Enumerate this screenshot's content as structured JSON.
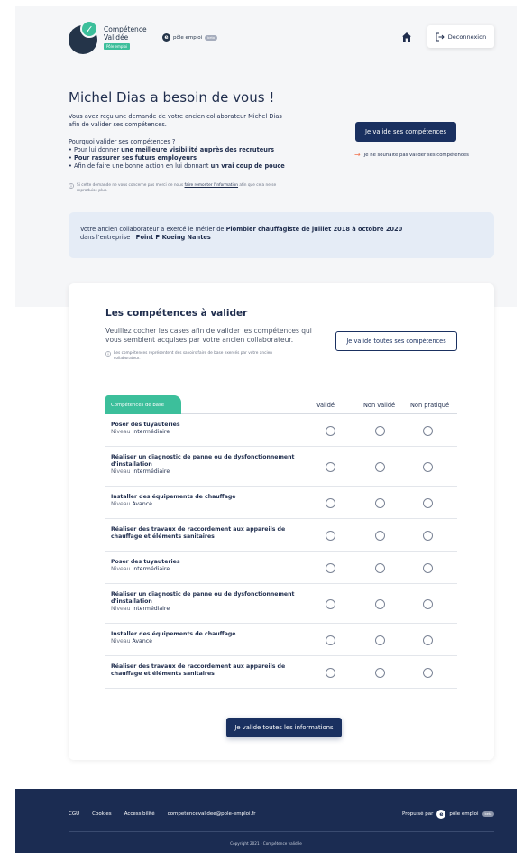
{
  "header": {
    "brand_name": "Compétence Validée",
    "brand_tag": "Pôle emploi",
    "partner_name": "pôle emploi",
    "partner_badge": "beta",
    "home_icon": "home-icon",
    "logout_label": "Deconnexion"
  },
  "hero": {
    "title": "Michel Dias a besoin de vous !",
    "intro": "Vous avez reçu une demande de votre ancien collaborateur Michel Dias afin de valider ses compétences.",
    "why_title": "Pourquoi valider ses compétences ?",
    "reasons": [
      {
        "pre": "Pour lui donner ",
        "bold": "une meilleure visibilité auprès des recruteurs",
        "post": ""
      },
      {
        "pre": "",
        "bold": "Pour rassurer ses futurs employeurs",
        "post": ""
      },
      {
        "pre": "Afin de faire une bonne action en lui donnant ",
        "bold": "un vrai coup de pouce",
        "post": ""
      }
    ],
    "note_pre": "Si cette demande ne vous concerne pas merci de nous ",
    "note_link": "faire remonter l'information",
    "note_post": " afin que cela ne se reproduise plus.",
    "validate_button": "Je valide ses compétences",
    "refuse_link": "Je ne souhaite pas valider ses compétences"
  },
  "banner": {
    "pre": "Votre ancien collaborateur a exercé le métier de ",
    "job": "Plombier chauffagiste de juillet 2018 à octobre 2020",
    "mid": "dans l'entreprise : ",
    "company": "Point P Koeing Nantes"
  },
  "skills": {
    "title": "Les compétences à valider",
    "subtitle": "Veuillez cocher les cases afin de valider les compétences qui vous semblent acquises par votre ancien collaborateur.",
    "note": "Les compétences représentent des savoirs faire de base exercés par votre ancien collaborateur.",
    "validate_all_button": "Je valide toutes ses compétences",
    "tab_label": "Compétences de base",
    "columns": [
      "Validé",
      "Non validé",
      "Non pratiqué"
    ],
    "level_prefix": "Niveau ",
    "rows": [
      {
        "name": "Poser des tuyauteries",
        "level": "Intermédiaire"
      },
      {
        "name": "Réaliser un diagnostic de panne ou de dysfonctionnement d'installation",
        "level": "Intermédiaire"
      },
      {
        "name": "Installer des équipements de chauffage",
        "level": "Avancé"
      },
      {
        "name": "Réaliser des travaux de raccordement aux appareils de chauffage et éléments sanitaires",
        "level": ""
      },
      {
        "name": "Poser des tuyauteries",
        "level": "Intermédiaire"
      },
      {
        "name": "Réaliser un diagnostic de panne ou de dysfonctionnement d'installation",
        "level": "Intermédiaire"
      },
      {
        "name": "Installer des équipements de chauffage",
        "level": "Avancé"
      },
      {
        "name": "Réaliser des travaux de raccordement aux appareils de chauffage et éléments sanitaires",
        "level": ""
      }
    ],
    "submit_button": "Je valide toutes les informations"
  },
  "footer": {
    "links": [
      "CGU",
      "Cookies",
      "Accessibilité",
      "competencevalidee@pole-emploi.fr"
    ],
    "powered_by": "Propulsé par",
    "partner_name": "pôle emploi",
    "partner_badge": "beta",
    "copyright": "Copyright 2021 - Compétence validée"
  },
  "colors": {
    "primary": "#1a3060",
    "accent": "#3cbf9b",
    "link_arrow": "#f0734f",
    "banner_bg": "#e5ecf6"
  }
}
